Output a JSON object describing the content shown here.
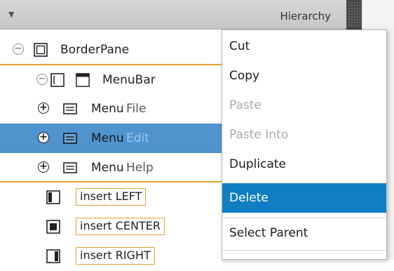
{
  "panel": {
    "dropdown_glyph": "▼",
    "title": "Hierarchy"
  },
  "tree": {
    "root": {
      "expander": "−",
      "icon": "borderpane-icon",
      "label": "BorderPane"
    },
    "menubar": {
      "expander": "−",
      "icon": "menubar-icon",
      "label": "MenuBar"
    },
    "menus": [
      {
        "expander": "+",
        "icon": "menu-icon",
        "label": "Menu",
        "text": "File"
      },
      {
        "expander": "+",
        "icon": "menu-icon",
        "label": "Menu",
        "text": "Edit",
        "selected": true
      },
      {
        "expander": "+",
        "icon": "menu-icon",
        "label": "Menu",
        "text": "Help"
      }
    ],
    "inserts": [
      {
        "icon": "left-region-icon",
        "label": "insert LEFT"
      },
      {
        "icon": "center-region-icon",
        "label": "insert CENTER"
      },
      {
        "icon": "right-region-icon",
        "label": "insert RIGHT"
      }
    ]
  },
  "context_menu": {
    "items": [
      {
        "label": "Cut",
        "enabled": true
      },
      {
        "label": "Copy",
        "enabled": true
      },
      {
        "label": "Paste",
        "enabled": false
      },
      {
        "label": "Paste Into",
        "enabled": false
      },
      {
        "label": "Duplicate",
        "enabled": true
      },
      {
        "label": "Delete",
        "enabled": true,
        "highlighted": true
      },
      {
        "label": "Select Parent",
        "enabled": true
      }
    ]
  },
  "colors": {
    "selection": "#4f93cf",
    "menu_highlight": "#0f7ec2",
    "drop_line": "#e3a12f"
  }
}
